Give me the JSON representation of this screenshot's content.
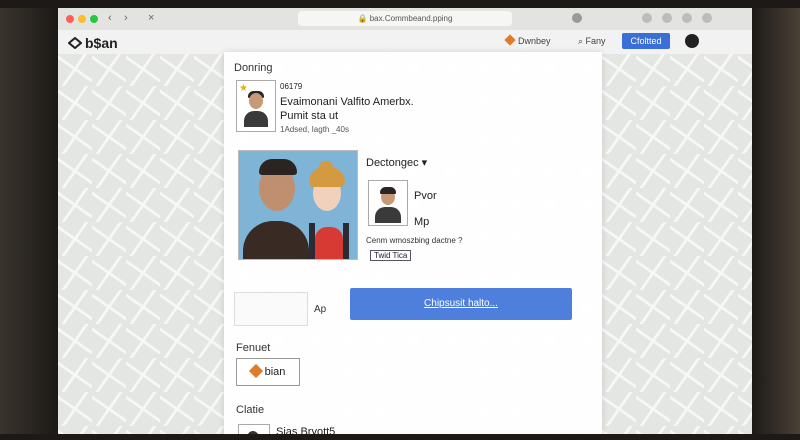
{
  "browser": {
    "url": "bax.Commbeand.pping"
  },
  "app": {
    "brand": "b$an",
    "links": [
      "Dwnbey",
      "Fany"
    ],
    "apply_label": "Cfoltted"
  },
  "panel": {
    "section_title": "Donring",
    "badge_number": "06179",
    "card_name": "Evaimonani Valfito Amerbx.",
    "card_subtitle": "Pumit sta ut",
    "card_meta": "1Adsed, Iagth _40s",
    "dropdown_label": "Dectongec",
    "option_1": "Pvor",
    "option_2": "Mp",
    "question": "Cenm wmoszbing dactne ?",
    "tag": "Twid Tica",
    "ap_label": "Ap",
    "cta_label": "Chipsusit halto...",
    "section_2": "Fenuet",
    "bian_label": "bian",
    "section_3": "Clatie",
    "person_name": "Sjas Bryott5"
  },
  "colors": {
    "accent": "#4f7fdc",
    "brand_orange": "#e07b2a"
  }
}
